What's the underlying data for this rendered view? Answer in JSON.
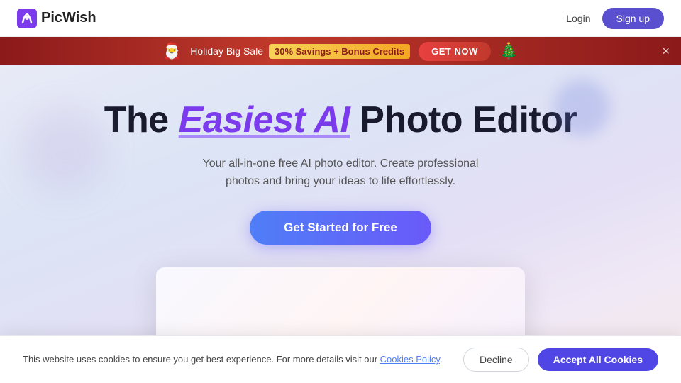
{
  "navbar": {
    "logo_text": "PicWish",
    "login_label": "Login",
    "signup_label": "Sign up"
  },
  "banner": {
    "prefix_text": "Holiday Big Sale",
    "highlight_text": "30% Savings + Bonus Credits",
    "cta_label": "GET NOW",
    "close_label": "×"
  },
  "hero": {
    "title_prefix": "The ",
    "title_highlight": "Easiest AI",
    "title_suffix": " Photo Editor",
    "subtitle": "Your all-in-one free AI photo editor. Create professional photos and bring your ideas to life effortlessly.",
    "cta_label": "Get Started for Free"
  },
  "cookie": {
    "text": "This website uses cookies to ensure you get best experience. For more details visit our ",
    "link_text": "Cookies Policy",
    "link_suffix": ".",
    "decline_label": "Decline",
    "accept_label": "Accept All Cookies"
  }
}
